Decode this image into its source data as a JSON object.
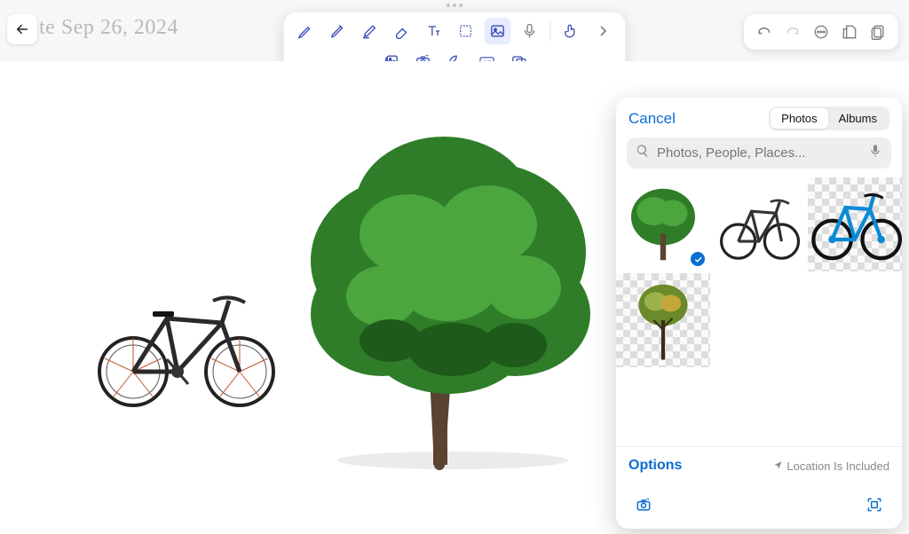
{
  "header": {
    "title": "te Sep 26, 2024"
  },
  "toolbar": {
    "tools_row1": [
      "pencil",
      "pen",
      "highlighter",
      "eraser",
      "text",
      "lasso",
      "image",
      "mic",
      "gesture",
      "more"
    ],
    "tools_row2": [
      "photo-stack",
      "camera",
      "shapes",
      "gif",
      "sticker"
    ],
    "selected": "image"
  },
  "right_tools": [
    "undo",
    "redo",
    "more",
    "export",
    "pages"
  ],
  "picker": {
    "cancel_label": "Cancel",
    "segments": {
      "photos": "Photos",
      "albums": "Albums",
      "active": "photos"
    },
    "search_placeholder": "Photos, People, Places...",
    "thumbs": [
      {
        "id": "tree-green",
        "selected": true
      },
      {
        "id": "bike-black",
        "selected": false
      },
      {
        "id": "bike-blue",
        "selected": false,
        "checker": true
      },
      {
        "id": "tree-autumn",
        "selected": false,
        "checker": true
      },
      {
        "id": "blank-1",
        "selected": false
      },
      {
        "id": "blank-2",
        "selected": false
      }
    ],
    "options_label": "Options",
    "location_label": "Location Is Included"
  }
}
